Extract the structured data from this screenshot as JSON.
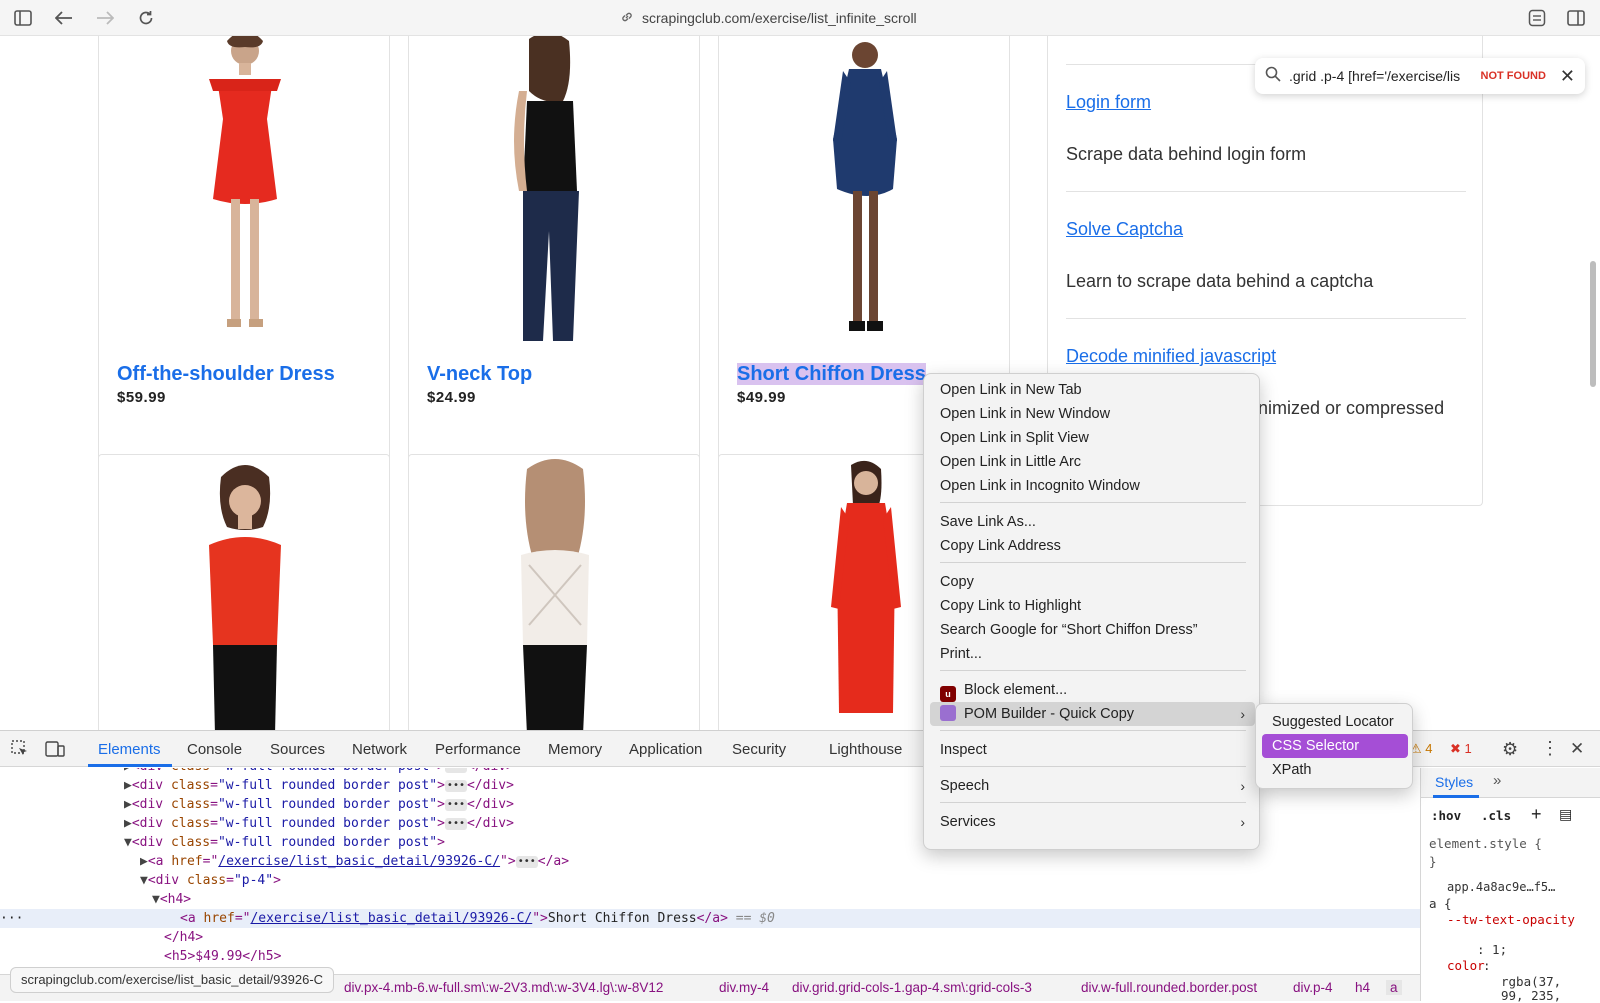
{
  "browser": {
    "url": "scrapingclub.com/exercise/list_infinite_scroll",
    "icons": [
      "sidebar-toggle-icon",
      "back-icon",
      "forward-icon",
      "reload-icon",
      "link-icon",
      "extensions-icon",
      "split-view-icon"
    ]
  },
  "products": [
    {
      "name": "Off-the-shoulder Dress",
      "price": "$59.99",
      "image": "red-dress"
    },
    {
      "name": "V-neck Top",
      "price": "$24.99",
      "image": "black-top"
    },
    {
      "name": "Short Chiffon Dress",
      "price": "$49.99",
      "image": "navy-dress",
      "highlighted": true
    },
    {
      "name": "",
      "price": "",
      "image": "red-cami"
    },
    {
      "name": "",
      "price": "",
      "image": "white-cami"
    },
    {
      "name": "",
      "price": "",
      "image": "red-lace-dress"
    }
  ],
  "sidebar": {
    "top_text": "",
    "items": [
      {
        "link": "Login form",
        "desc": "Scrape data behind login form"
      },
      {
        "link": "Solve Captcha",
        "desc": "Learn to scrape data behind a captcha"
      },
      {
        "link": "Decode minified javascript",
        "desc": "nimized or compressed"
      }
    ]
  },
  "findbar": {
    "query": ".grid .p-4 [href='/exercise/lis",
    "status": "NOT FOUND"
  },
  "context_menu": {
    "items": [
      "Open Link in New Tab",
      "Open Link in New Window",
      "Open Link in Split View",
      "Open Link in Little Arc",
      "Open Link in Incognito Window",
      "Save Link As...",
      "Copy Link Address",
      "Copy",
      "Copy Link to Highlight",
      "Search Google for “Short Chiffon Dress”",
      "Print...",
      "Block element...",
      "POM Builder - Quick Copy",
      "Inspect",
      "Speech",
      "Services"
    ],
    "submenu": [
      "Suggested Locator",
      "CSS Selector",
      "XPath"
    ]
  },
  "devtools": {
    "tabs": [
      "Elements",
      "Console",
      "Sources",
      "Network",
      "Performance",
      "Memory",
      "Application",
      "Security",
      "Lighthouse"
    ],
    "warnings": "4",
    "errors": "1",
    "dom": {
      "div_tag": "div",
      "class_attr": "class",
      "post_class": "\"w-full rounded border post\"",
      "href_attr": "href",
      "href_val": "/exercise/list_basic_detail/93926-C/",
      "p4_class": "\"p-4\"",
      "a_close": "</a>",
      "div_close": "</div>",
      "h4_open": "<h4>",
      "h4_close": "</h4>",
      "link_text": "Short Chiffon Dress",
      "eq": "== $0",
      "cut_line": "<h5>$49.99</h5>"
    },
    "hover_url": "scrapingclub.com/exercise/list_basic_detail/93926-C",
    "breadcrumbs": [
      "div.px-4.mb-6.w-full.sm\\:w-2V3.md\\:w-3V4.lg\\:w-8V12",
      "div.my-4",
      "div.grid.grid-cols-1.gap-4.sm\\:grid-cols-3",
      "div.w-full.rounded.border.post",
      "div.p-4",
      "h4",
      "a"
    ],
    "styles": {
      "tab": "Styles",
      "hov": ":hov",
      "cls": ".cls",
      "element_style": "element.style {",
      "close_brace": "}",
      "source": "app.4a8ac9e…f5…",
      "selector": "a {",
      "prop1": "--tw-text-opacity",
      "val1": ": 1;",
      "prop2": "color",
      "val2": "rgba(37,",
      "val2b": "99, 235,"
    }
  }
}
